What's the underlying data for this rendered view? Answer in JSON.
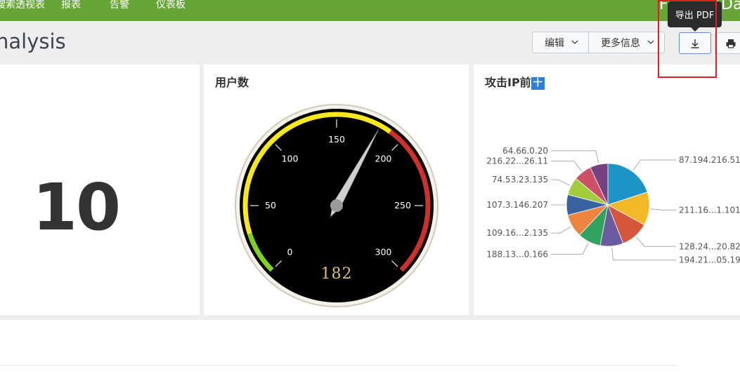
{
  "nav": {
    "items": [
      "搜索透视表",
      "报表",
      "告警",
      "仪表板"
    ],
    "brand": "FromainData"
  },
  "header": {
    "title": "nalysis",
    "edit_label": "编辑",
    "more_label": "更多信息",
    "tooltip": "导出 PDF"
  },
  "panels": {
    "single": {
      "value": "10"
    },
    "gauge": {
      "title": "用户数",
      "value": 182,
      "value_text": "182",
      "ticks": [
        "0",
        "50",
        "100",
        "150",
        "200",
        "250",
        "300"
      ],
      "range": [
        0,
        300
      ],
      "bands": [
        {
          "from": 0,
          "to": 30,
          "color": "#7ed321"
        },
        {
          "from": 30,
          "to": 190,
          "color": "#f8e71c"
        },
        {
          "from": 190,
          "to": 300,
          "color": "#d0302b"
        }
      ]
    },
    "pie": {
      "title": "攻击IP前",
      "title_badge": "十"
    }
  },
  "chart_data": {
    "type": "pie",
    "slices": [
      {
        "label": "87.194.216.51",
        "value": 20,
        "color": "#1e93c6"
      },
      {
        "label": "211.16...1.101",
        "value": 13,
        "color": "#f2b827"
      },
      {
        "label": "128.24...20.82",
        "value": 11,
        "color": "#d6563c"
      },
      {
        "label": "194.21...05.19",
        "value": 9,
        "color": "#6a5c9e"
      },
      {
        "label": "188.13...0.166",
        "value": 9,
        "color": "#31a35f"
      },
      {
        "label": "109.16...2.135",
        "value": 9,
        "color": "#ed8440"
      },
      {
        "label": "107.3.146.207",
        "value": 8,
        "color": "#3863a0"
      },
      {
        "label": "74.53.23.135",
        "value": 7,
        "color": "#a2cc3e"
      },
      {
        "label": "216.22...26.11",
        "value": 7,
        "color": "#cc5068"
      },
      {
        "label": "64.66.0.20",
        "value": 7,
        "color": "#73427f"
      }
    ]
  }
}
